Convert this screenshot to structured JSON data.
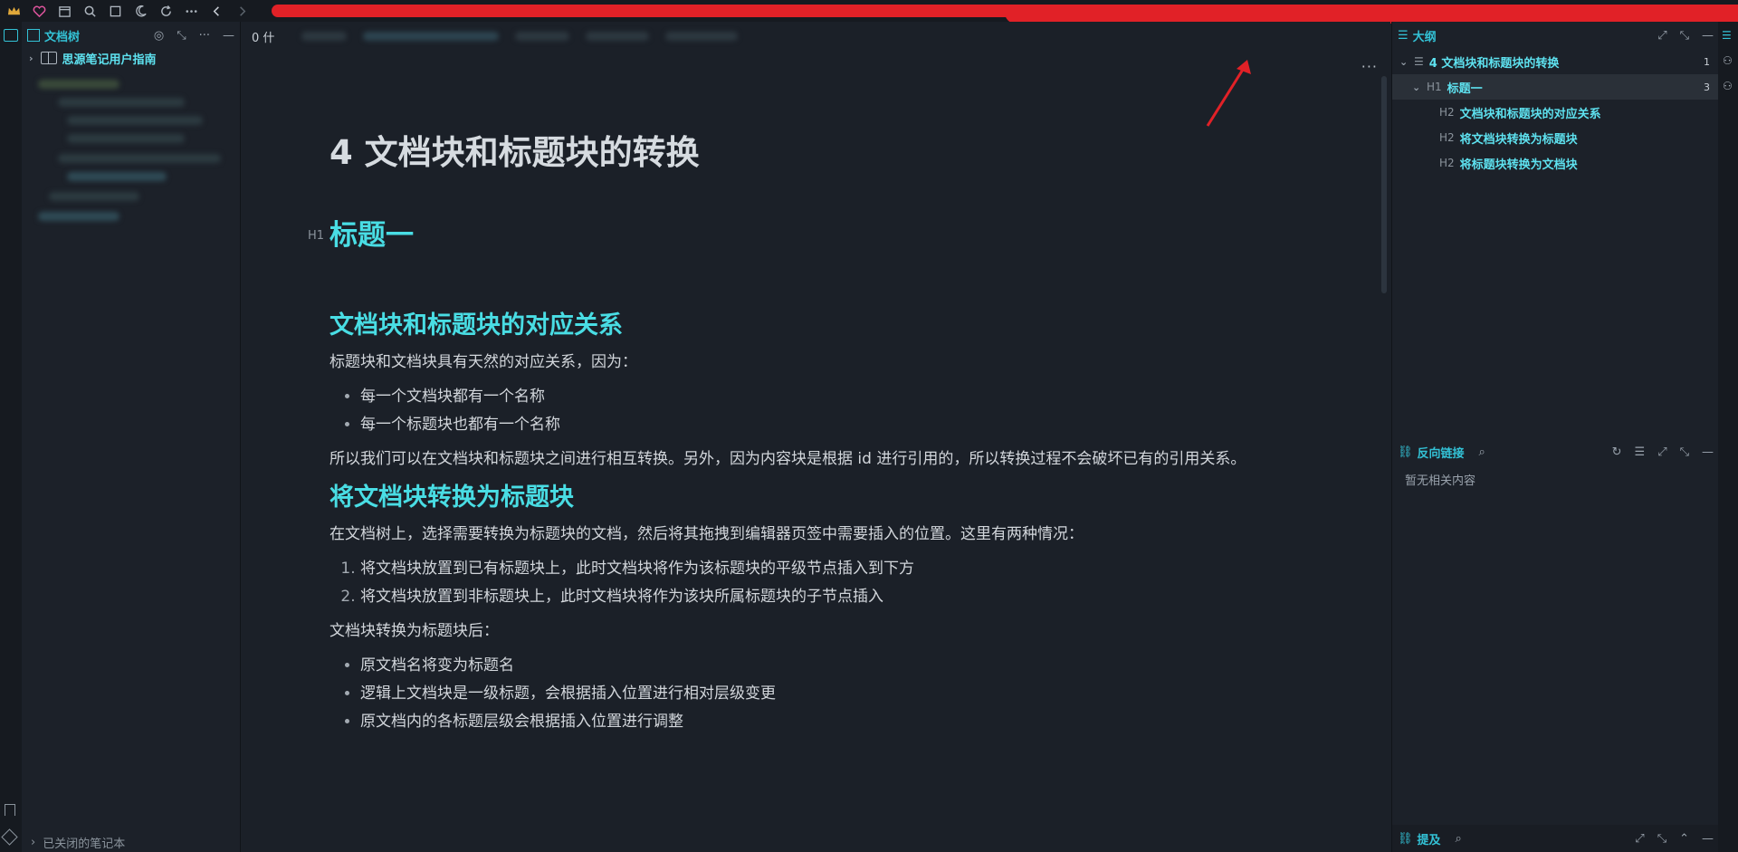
{
  "titlebar": {
    "icons": [
      "crown-icon",
      "heart-icon",
      "calendar-icon",
      "search-icon",
      "square-icon",
      "moon-icon",
      "sync-icon",
      "more-icon",
      "back-icon",
      "forward-icon"
    ]
  },
  "left_panel": {
    "title": "文档树",
    "notebook": "思源笔记用户指南",
    "closed_notebooks": "已关闭的笔记本"
  },
  "editor": {
    "tab_label": "0 什",
    "doc_title": "4 文档块和标题块的转换",
    "h1_badge": "H1",
    "h1": "标题一",
    "sections": {
      "s1_title": "文档块和标题块的对应关系",
      "s1_p1": "标题块和文档块具有天然的对应关系，因为：",
      "s1_bullets": [
        "每一个文档块都有一个名称",
        "每一个标题块也都有一个名称"
      ],
      "s1_p2": "所以我们可以在文档块和标题块之间进行相互转换。另外，因为内容块是根据 id 进行引用的，所以转换过程不会破坏已有的引用关系。",
      "s2_title": "将文档块转换为标题块",
      "s2_p1": "在文档树上，选择需要转换为标题块的文档，然后将其拖拽到编辑器页签中需要插入的位置。这里有两种情况：",
      "s2_list": [
        "将文档块放置到已有标题块上，此时文档块将作为该标题块的平级节点插入到下方",
        "将文档块放置到非标题块上，此时文档块将作为该块所属标题块的子节点插入"
      ],
      "s2_p2": "文档块转换为标题块后：",
      "s2_bullets": [
        "原文档名将变为标题名",
        "逻辑上文档块是一级标题，会根据插入位置进行相对层级变更",
        "原文档内的各标题层级会根据插入位置进行调整"
      ]
    }
  },
  "outline": {
    "title": "大纲",
    "items": [
      {
        "label": "4 文档块和标题块的转换",
        "count": "1"
      },
      {
        "badge": "H1",
        "label": "标题一",
        "count": "3"
      },
      {
        "badge": "H2",
        "label": "文档块和标题块的对应关系"
      },
      {
        "badge": "H2",
        "label": "将文档块转换为标题块"
      },
      {
        "badge": "H2",
        "label": "将标题块转换为文档块"
      }
    ]
  },
  "backlinks": {
    "title": "反向链接",
    "empty": "暂无相关内容"
  },
  "mentions": {
    "title": "提及"
  },
  "colors": {
    "accent": "#49dde4",
    "redaction": "#e12127",
    "background": "#1b2028"
  }
}
